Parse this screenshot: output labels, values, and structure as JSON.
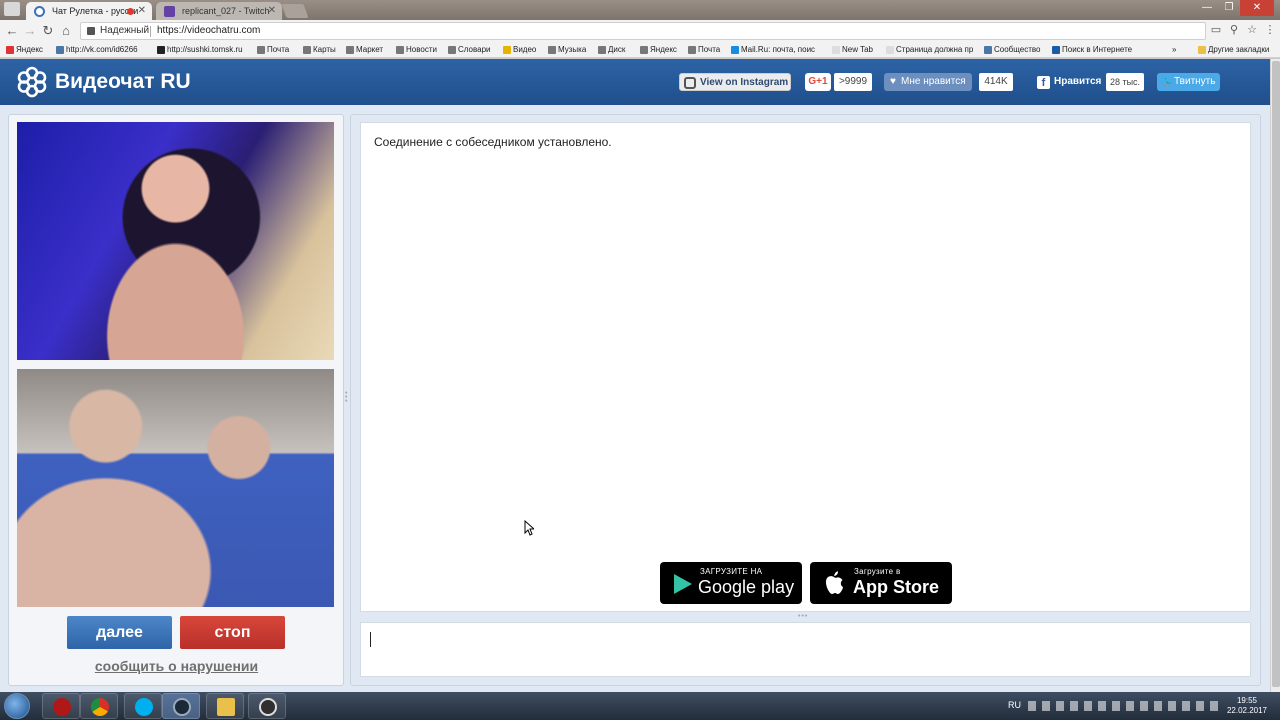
{
  "browser": {
    "tabs": [
      {
        "label": "Чат Рулетка - русски"
      },
      {
        "label": "replicant_027 - Twitch"
      }
    ],
    "address": {
      "security_label": "Надежный",
      "url": "https://videochatru.com"
    },
    "bookmarks": [
      "Яндекс",
      "http://vk.com/id6266",
      "http://sushki.tomsk.ru",
      "Почта",
      "Карты",
      "Маркет",
      "Новости",
      "Словари",
      "Видео",
      "Музыка",
      "Диск",
      "Яндекс",
      "Почта",
      "Mail.Ru: почта, поис",
      "New Tab",
      "Страница должна пр",
      "Сообщество",
      "Поиск в Интернете",
      "Другие закладки"
    ],
    "bookmarks_overflow": "»"
  },
  "site": {
    "brand": "Видеочат RU",
    "social": {
      "instagram_label": "View on Instagram",
      "gplus_label": "G+1",
      "gplus_count": ">9999",
      "vk_like_label": "Мне нравится",
      "vk_count": "414K",
      "fb_like_label": "Нравится",
      "fb_count": "28 тыс.",
      "tweet_label": "Твитнуть"
    },
    "buttons": {
      "next_label": "далее",
      "stop_label": "стоп"
    },
    "report_link": "сообщить о нарушении",
    "chat": {
      "system_message": "Соединение с собеседником установлено.",
      "input_value": ""
    },
    "stores": {
      "google_small": "ЗАГРУЗИТЕ НА",
      "google_big": "Google play",
      "apple_small": "Загрузите в",
      "apple_big": "App Store"
    }
  },
  "taskbar": {
    "language": "RU",
    "time": "19:55",
    "date": "22.02.2017",
    "apps": [
      "app-icon",
      "chrome-icon",
      "skype-icon",
      "steam-icon",
      "folder-icon",
      "obs-icon"
    ]
  },
  "colors": {
    "header_blue": "#2c63a5",
    "next_button": "#3a74bb",
    "stop_button": "#c83a30",
    "page_bg": "#dfe8f3"
  }
}
